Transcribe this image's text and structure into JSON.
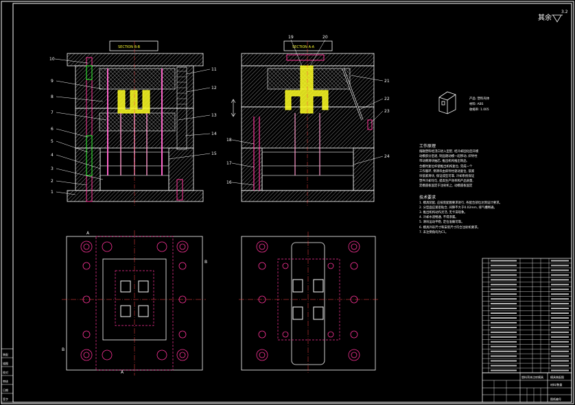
{
  "corner_symbol": {
    "text": "其余",
    "value": "3.2"
  },
  "views": {
    "section_left_title": "SECTION B-B",
    "section_right_title": "SECTION A-A",
    "marker_a": "A",
    "marker_b": "B"
  },
  "callouts_left": [
    "10",
    "9",
    "8",
    "7",
    "6",
    "5",
    "4",
    "3",
    "2",
    "1"
  ],
  "callouts_right_of_left": [
    "11",
    "12",
    "13",
    "14",
    "15"
  ],
  "callouts_top_right": [
    "19",
    "20"
  ],
  "callouts_right": [
    "21",
    "22",
    "23",
    "24"
  ],
  "callouts_left_of_right": [
    "18",
    "17",
    "16"
  ],
  "product": {
    "name": "产品: 塑料壳体",
    "material": "材料: ABS",
    "shrink": "收缩率: 1.005"
  },
  "notes": {
    "work_title": "工作原理",
    "work_lines": [
      "熔融塑料经浇口进入型腔, 经冷却固化后开模",
      "动模部分后退, 制品随动模一起移动, 斜导柱",
      "带动侧滑块抽芯, 推出机构推出制品,",
      "合模时复位杆使推出机构复位, 完成一个",
      "工作循环, 侧滑块由斜导柱驱动复位, 锁紧",
      "块锁紧滑块, 保证成型可靠, 冷却系统保证",
      "塑件冷却均匀, 提高生产效率和产品质量,",
      "定模座板固定于注射机上, 动模座板固定"
    ],
    "tech_title": "技术要求",
    "tech_lines": [
      "1. 模具装配, 应按装配图要求进行, 各配合部位达到设计要求。",
      "2. 分型面应紧密贴合, 间隙不大于0.02mm, 排气槽畅通。",
      "3. 推出机构动作灵活, 无卡滞现象。",
      "4. 冷却水道畅通, 不得渗漏。",
      "5. 滑块运动平稳, 定位准确可靠。",
      "6. 模具外形尺寸和安装尺寸符合注射机要求。",
      "7. 未注倒角均为C1。"
    ]
  },
  "bom_rows": 24,
  "title_block": {
    "row1": "塑料壳体注射模具",
    "row2": "模具装配图",
    "row3": "材料/数量",
    "row4": "图纸编号"
  },
  "side_strip": [
    "装配",
    "描图",
    "校对",
    "审核",
    "日期",
    "签字"
  ]
}
